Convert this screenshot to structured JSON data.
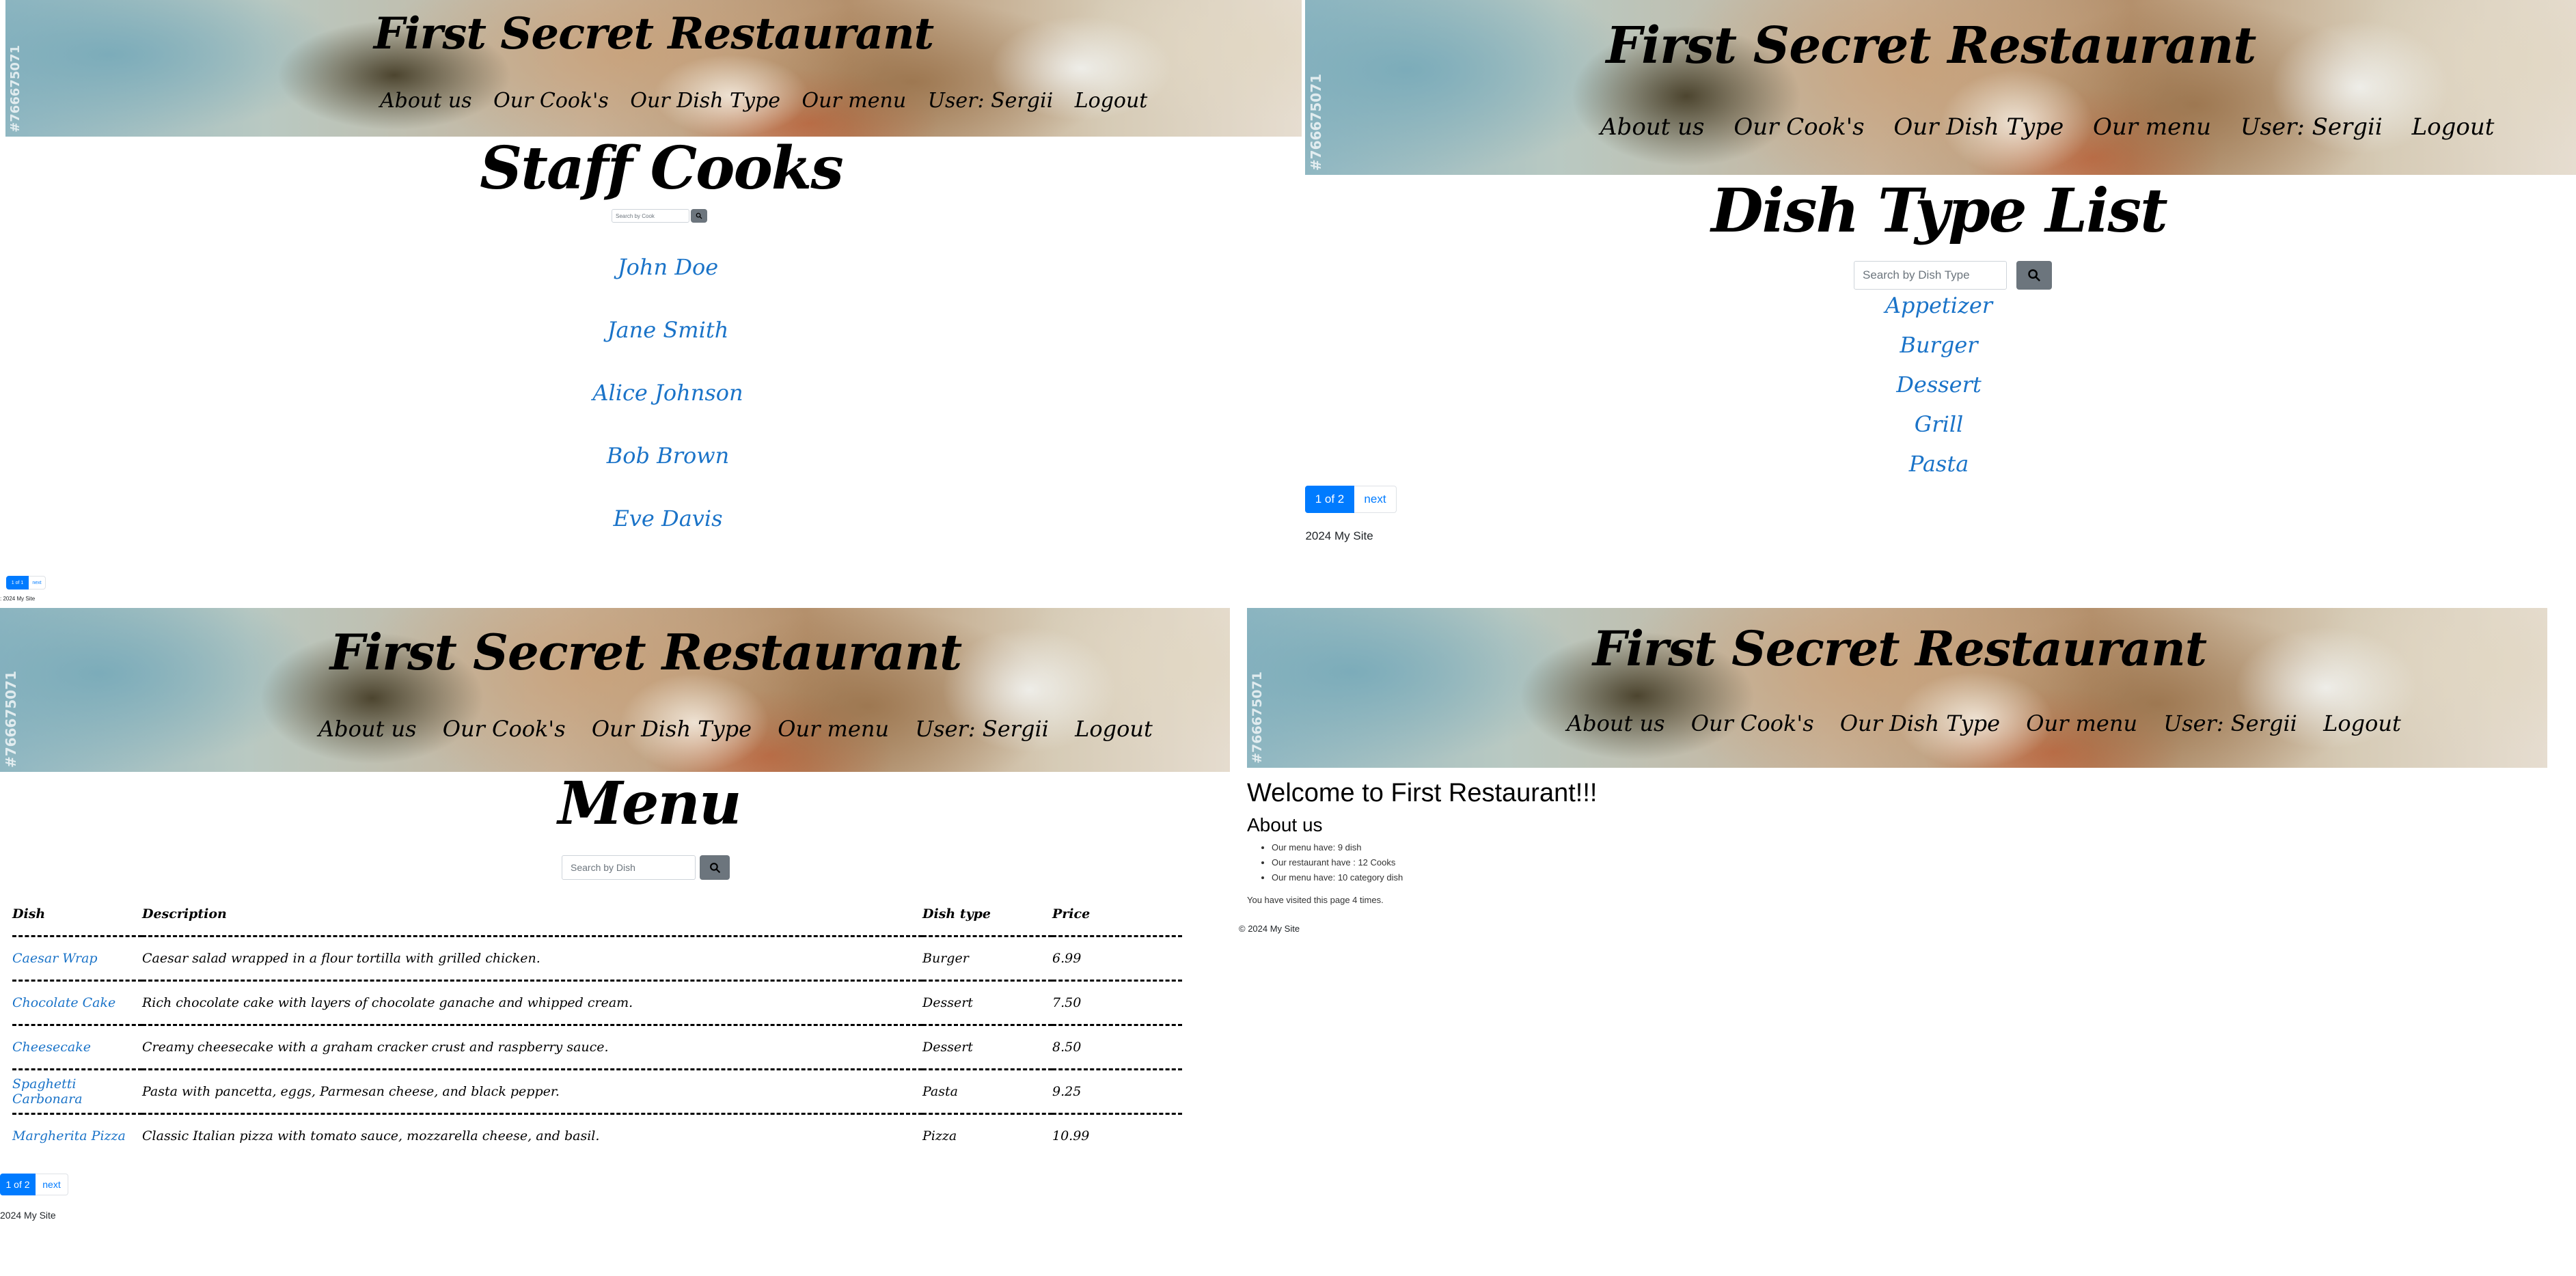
{
  "site": {
    "title": "First Secret Restaurant",
    "watermark": "#766675071",
    "nav": [
      "About us",
      "Our Cook's",
      "Our Dish Type",
      "Our menu",
      "User: Sergii",
      "Logout"
    ],
    "footer": "2024 My Site",
    "footer_copy": "© 2024 My Site",
    "footer_cut": ": 2024 My Site"
  },
  "cooks_page": {
    "heading": "Staff Cooks",
    "search_placeholder": "Search by Cook",
    "cooks": [
      "John Doe",
      "Jane Smith",
      "Alice Johnson",
      "Bob Brown",
      "Eve Davis"
    ],
    "pagination": {
      "current": "1 of 1",
      "next": "next"
    }
  },
  "dish_type_page": {
    "heading": "Dish Type List",
    "search_placeholder": "Search by Dish Type",
    "dish_types": [
      "Appetizer",
      "Burger",
      "Dessert",
      "Grill",
      "Pasta"
    ],
    "pagination": {
      "current": "1 of 2",
      "next": "next"
    }
  },
  "menu_page": {
    "heading": "Menu",
    "search_placeholder": "Search by Dish",
    "columns": [
      "Dish",
      "Description",
      "Dish type",
      "Price"
    ],
    "rows": [
      {
        "dish": "Caesar Wrap",
        "description": "Caesar salad wrapped in a flour tortilla with grilled chicken.",
        "dish_type": "Burger",
        "price": "6.99"
      },
      {
        "dish": "Chocolate Cake",
        "description": "Rich chocolate cake with layers of chocolate ganache and whipped cream.",
        "dish_type": "Dessert",
        "price": "7.50"
      },
      {
        "dish": "Cheesecake",
        "description": "Creamy cheesecake with a graham cracker crust and raspberry sauce.",
        "dish_type": "Dessert",
        "price": "8.50"
      },
      {
        "dish": "Spaghetti Carbonara",
        "description": "Pasta with pancetta, eggs, Parmesan cheese, and black pepper.",
        "dish_type": "Pasta",
        "price": "9.25"
      },
      {
        "dish": "Margherita Pizza",
        "description": "Classic Italian pizza with tomato sauce, mozzarella cheese, and basil.",
        "dish_type": "Pizza",
        "price": "10.99"
      }
    ],
    "pagination": {
      "current": "1 of 2",
      "next": "next"
    }
  },
  "home_page": {
    "welcome": "Welcome to First Restaurant!!!",
    "about_heading": "About us",
    "facts": [
      "Our menu have: 9 dish",
      "Our restaurant have : 12 Cooks",
      "Our menu have: 10 category dish"
    ],
    "visits": "You have visited this page 4 times."
  },
  "colors": {
    "link": "#1a73c8",
    "primary": "#007bff",
    "search_button": "#6c757d"
  },
  "icons": [
    "search-icon"
  ]
}
